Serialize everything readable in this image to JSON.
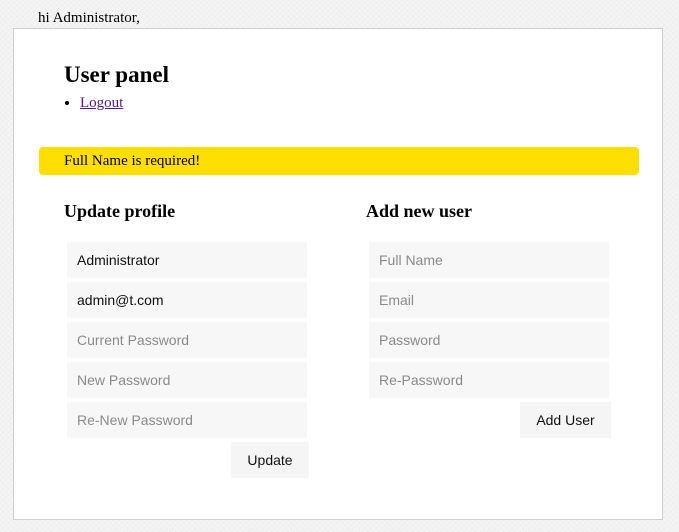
{
  "header": {
    "greeting": "hi Administrator,"
  },
  "panel": {
    "title": "User panel",
    "nav": {
      "logout_label": "Logout"
    },
    "alert": {
      "message": "Full Name is required!",
      "color": "#ffde00"
    }
  },
  "update_profile": {
    "title": "Update profile",
    "full_name_value": "Administrator",
    "email_value": "admin@t.com",
    "current_password_placeholder": "Current Password",
    "new_password_placeholder": "New Password",
    "re_new_password_placeholder": "Re-New Password",
    "submit_label": "Update"
  },
  "add_user": {
    "title": "Add new user",
    "full_name_placeholder": "Full Name",
    "email_placeholder": "Email",
    "password_placeholder": "Password",
    "re_password_placeholder": "Re-Password",
    "submit_label": "Add User"
  }
}
